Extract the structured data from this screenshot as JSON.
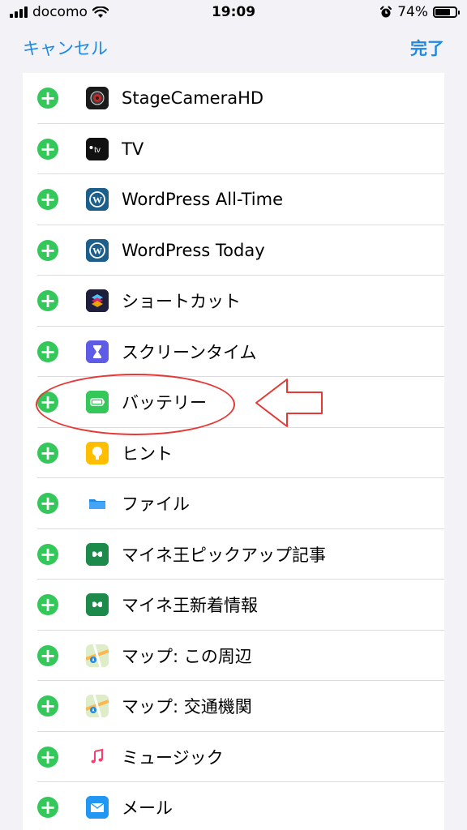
{
  "status_bar": {
    "carrier": "docomo",
    "time": "19:09",
    "battery": "74%",
    "battery_level": 0.74,
    "icons": [
      "signal-icon",
      "wifi-icon",
      "alarm-icon",
      "battery-icon"
    ]
  },
  "nav": {
    "cancel_label": "キャンセル",
    "done_label": "完了"
  },
  "colors": {
    "accent": "#1e88e5",
    "add_button": "#34c759",
    "annotation": "#e53935"
  },
  "items": [
    {
      "label": "StageCameraHD",
      "icon": "stagecamera-icon"
    },
    {
      "label": "TV",
      "icon": "tv-icon"
    },
    {
      "label": "WordPress All-Time",
      "icon": "wordpress-icon"
    },
    {
      "label": "WordPress Today",
      "icon": "wordpress-icon"
    },
    {
      "label": "ショートカット",
      "icon": "shortcuts-icon"
    },
    {
      "label": "スクリーンタイム",
      "icon": "hourglass-icon"
    },
    {
      "label": "バッテリー",
      "icon": "battery-icon"
    },
    {
      "label": "ヒント",
      "icon": "lightbulb-icon"
    },
    {
      "label": "ファイル",
      "icon": "folder-icon"
    },
    {
      "label": "マイネ王ピックアップ記事",
      "icon": "mineo-icon"
    },
    {
      "label": "マイネ王新着情報",
      "icon": "mineo-icon"
    },
    {
      "label": "マップ: この周辺",
      "icon": "maps-icon"
    },
    {
      "label": "マップ: 交通機関",
      "icon": "maps-icon"
    },
    {
      "label": "ミュージック",
      "icon": "music-icon"
    },
    {
      "label": "メール",
      "icon": "mail-icon"
    }
  ]
}
